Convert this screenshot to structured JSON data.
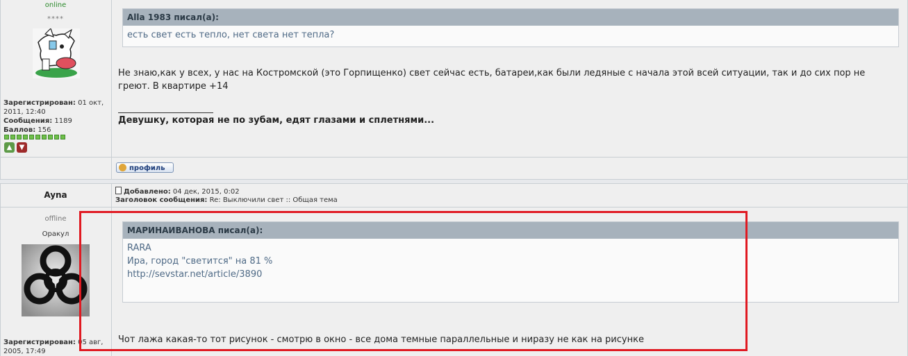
{
  "post1": {
    "user_status": "online",
    "user_rank": "****",
    "registered_label": "Зарегистрирован:",
    "registered_value": "01 окт, 2011, 12:40",
    "messages_label": "Сообщения:",
    "messages_value": "1189",
    "points_label": "Баллов:",
    "points_value": "156",
    "quote_author": "Alla 1983 писал(а):",
    "quote_text": "есть свет есть тепло, нет света нет тепла?",
    "text_line1": "Не знаю,как у всех, у нас на Костромской (это Горпищенко) свет сейчас есть, батареи,как были ледяные с начала этой всей ситуации, так и до сих пор не",
    "text_line2": "греют. В квартире +14",
    "signature": "Девушку, которая не по зубам, едят глазами и сплетнями...",
    "profile_button": "профиль"
  },
  "post2": {
    "username": "Ayna",
    "added_label": "Добавлено:",
    "added_value": "04 дек, 2015, 0:02",
    "subject_label": "Заголовок сообщения:",
    "subject_value": "Re: Выключили свет :: Общая тема",
    "user_status": "offline",
    "user_rank": "Оракул",
    "registered_label": "Зарегистрирован:",
    "registered_value": "05 авг, 2005, 17:49",
    "quote_author": "МАРИНАИВАНОВА писал(а):",
    "quote_line1": "RARA",
    "quote_line2": "Ира, город \"светится\" на 81 %",
    "quote_link": "http://sevstar.net/article/3890",
    "text": "Чот лажа какая-то тот рисунок - смотрю в окно - все дома темные параллельные и ниразу не как на рисунке"
  },
  "colors": {
    "highlight": "#e01921",
    "online": "#2b8a2b",
    "quote_header": "#a7b2bc"
  }
}
